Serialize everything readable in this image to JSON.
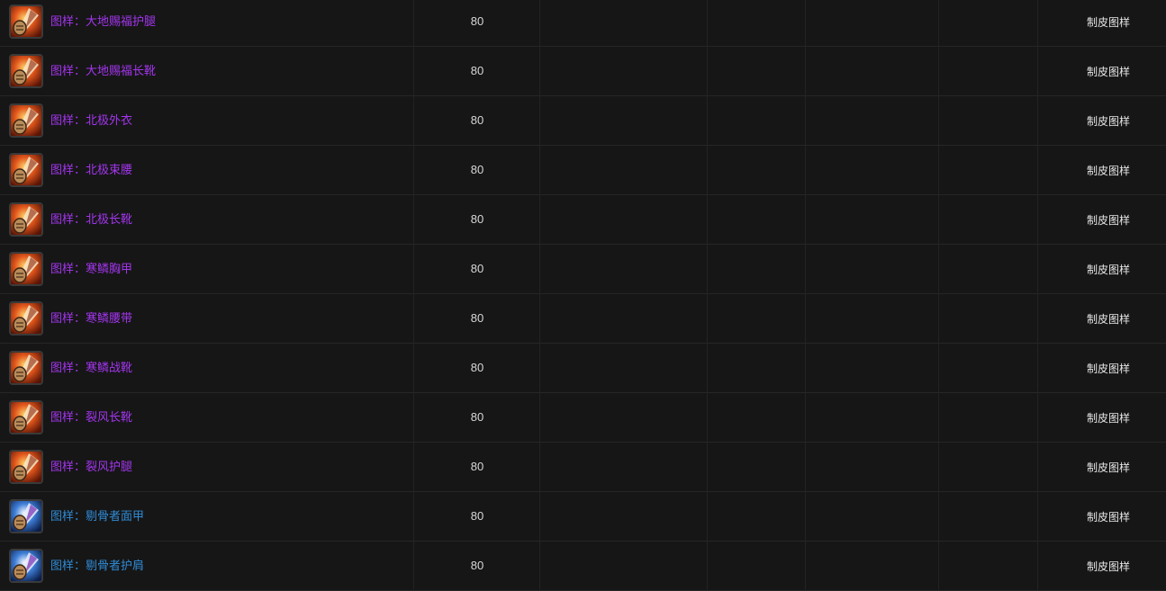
{
  "colors": {
    "epic": "#a335ee",
    "rare": "#2f8bd6",
    "background": "#161616"
  },
  "rows": [
    {
      "name": "图样：大地赐福护腿",
      "level": "80",
      "source": "制皮图样",
      "quality": "epic",
      "icon": "leatherworking-pattern-icon"
    },
    {
      "name": "图样：大地赐福长靴",
      "level": "80",
      "source": "制皮图样",
      "quality": "epic",
      "icon": "leatherworking-pattern-icon"
    },
    {
      "name": "图样：北极外衣",
      "level": "80",
      "source": "制皮图样",
      "quality": "epic",
      "icon": "leatherworking-pattern-icon"
    },
    {
      "name": "图样：北极束腰",
      "level": "80",
      "source": "制皮图样",
      "quality": "epic",
      "icon": "leatherworking-pattern-icon"
    },
    {
      "name": "图样：北极长靴",
      "level": "80",
      "source": "制皮图样",
      "quality": "epic",
      "icon": "leatherworking-pattern-icon"
    },
    {
      "name": "图样：寒鳞胸甲",
      "level": "80",
      "source": "制皮图样",
      "quality": "epic",
      "icon": "leatherworking-pattern-icon"
    },
    {
      "name": "图样：寒鳞腰带",
      "level": "80",
      "source": "制皮图样",
      "quality": "epic",
      "icon": "leatherworking-pattern-icon"
    },
    {
      "name": "图样：寒鳞战靴",
      "level": "80",
      "source": "制皮图样",
      "quality": "epic",
      "icon": "leatherworking-pattern-icon"
    },
    {
      "name": "图样：裂风长靴",
      "level": "80",
      "source": "制皮图样",
      "quality": "epic",
      "icon": "leatherworking-pattern-icon"
    },
    {
      "name": "图样：裂风护腿",
      "level": "80",
      "source": "制皮图样",
      "quality": "epic",
      "icon": "leatherworking-pattern-icon"
    },
    {
      "name": "图样：剔骨者面甲",
      "level": "80",
      "source": "制皮图样",
      "quality": "rare",
      "icon": "leatherworking-pattern-icon"
    },
    {
      "name": "图样：剔骨者护肩",
      "level": "80",
      "source": "制皮图样",
      "quality": "rare",
      "icon": "leatherworking-pattern-icon"
    }
  ]
}
